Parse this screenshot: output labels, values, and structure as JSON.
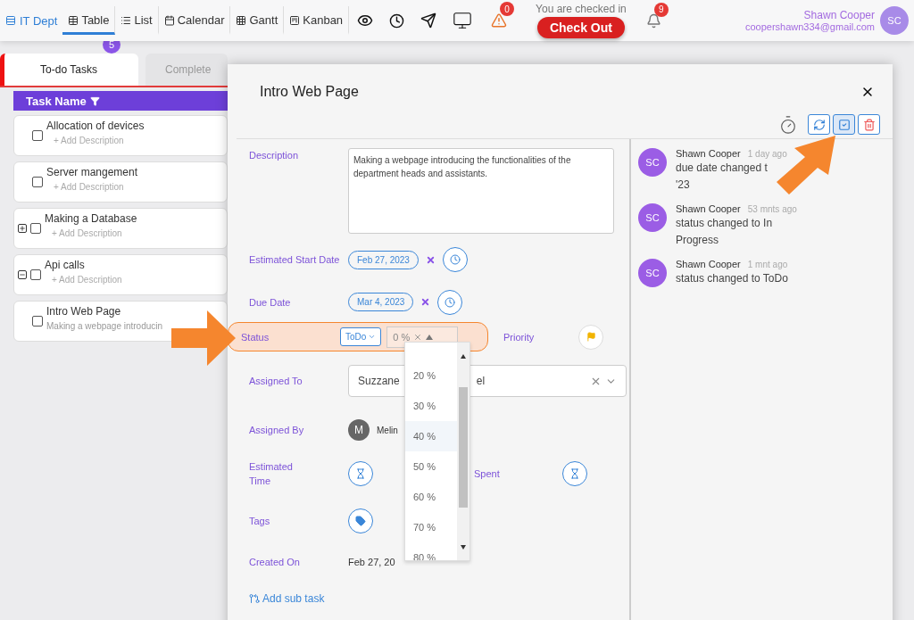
{
  "nav": {
    "brand": "IT Dept",
    "views": [
      {
        "label": "Table",
        "selected": true
      },
      {
        "label": "List",
        "selected": false
      },
      {
        "label": "Calendar",
        "selected": false
      },
      {
        "label": "Gantt",
        "selected": false
      },
      {
        "label": "Kanban",
        "selected": false
      }
    ],
    "alerts_badge": "0",
    "checkin_text": "You are checked in",
    "checkout_button": "Check Out",
    "notifications_badge": "9",
    "user": {
      "name": "Shawn Cooper",
      "email": "coopershawn334@gmail.com",
      "initials": "SC"
    }
  },
  "task_tabs": [
    {
      "label": "To-do Tasks",
      "badge": "5",
      "selected": true
    },
    {
      "label": "Complete",
      "selected": false
    }
  ],
  "task_column": "Task Name",
  "tasks": [
    {
      "name": "Allocation of devices",
      "placeholder": "+ Add Description",
      "checked": false,
      "kind": "leaf"
    },
    {
      "name": "Server mangement",
      "placeholder": "+ Add Description",
      "checked": false,
      "kind": "leaf"
    },
    {
      "name": "Making a Database",
      "placeholder": "+ Add Description",
      "checked": false,
      "kind": "parent",
      "expanded": false
    },
    {
      "name": "Api calls",
      "placeholder": "+ Add Description",
      "checked": false,
      "kind": "parent",
      "expanded": true
    },
    {
      "name": "Intro Web Page",
      "description": "Making a webpage introducin",
      "checked": false,
      "kind": "leaf"
    }
  ],
  "modal": {
    "title": "Intro Web Page",
    "description": {
      "label": "Description",
      "value": "Making a webpage introducing the functionalities of the department heads and assistants."
    },
    "start_date": {
      "label": "Estimated Start Date",
      "value": "Feb 27, 2023"
    },
    "due_date": {
      "label": "Due Date",
      "value": "Mar 4, 2023"
    },
    "status": {
      "label": "Status",
      "value": "ToDo",
      "percent": "0 %",
      "highlighted": true
    },
    "priority": {
      "label": "Priority"
    },
    "percent_options": [
      {
        "label": "20 %",
        "highlighted": false
      },
      {
        "label": "30 %",
        "highlighted": false
      },
      {
        "label": "40 %",
        "highlighted": true
      },
      {
        "label": "50 %",
        "highlighted": false
      },
      {
        "label": "60 %",
        "highlighted": false
      },
      {
        "label": "70 %",
        "highlighted": false
      },
      {
        "label": "80 %",
        "highlighted": false
      }
    ],
    "assigned_to": {
      "label": "Assigned To",
      "value_start": "Suzzane",
      "value_end": "el"
    },
    "assigned_by": {
      "label": "Assigned By",
      "initial": "M",
      "name": "Melin"
    },
    "estimated_time": {
      "label": "Estimated Time"
    },
    "time_spent": {
      "label": "Spent"
    },
    "tags": {
      "label": "Tags"
    },
    "created_on": {
      "label": "Created On",
      "value": "Feb 27, 20"
    },
    "add_subtask": "Add sub task",
    "activity": [
      {
        "initials": "SC",
        "author": "Shawn Cooper",
        "time": "1 day ago",
        "lines": [
          "due date changed t",
          "'23"
        ]
      },
      {
        "initials": "SC",
        "author": "Shawn Cooper",
        "time": "53 mnts ago",
        "lines": [
          "status changed to In",
          "Progress"
        ]
      },
      {
        "initials": "SC",
        "author": "Shawn Cooper",
        "time": "1 mnt ago",
        "lines": [
          "status changed to ToDo"
        ]
      }
    ]
  }
}
